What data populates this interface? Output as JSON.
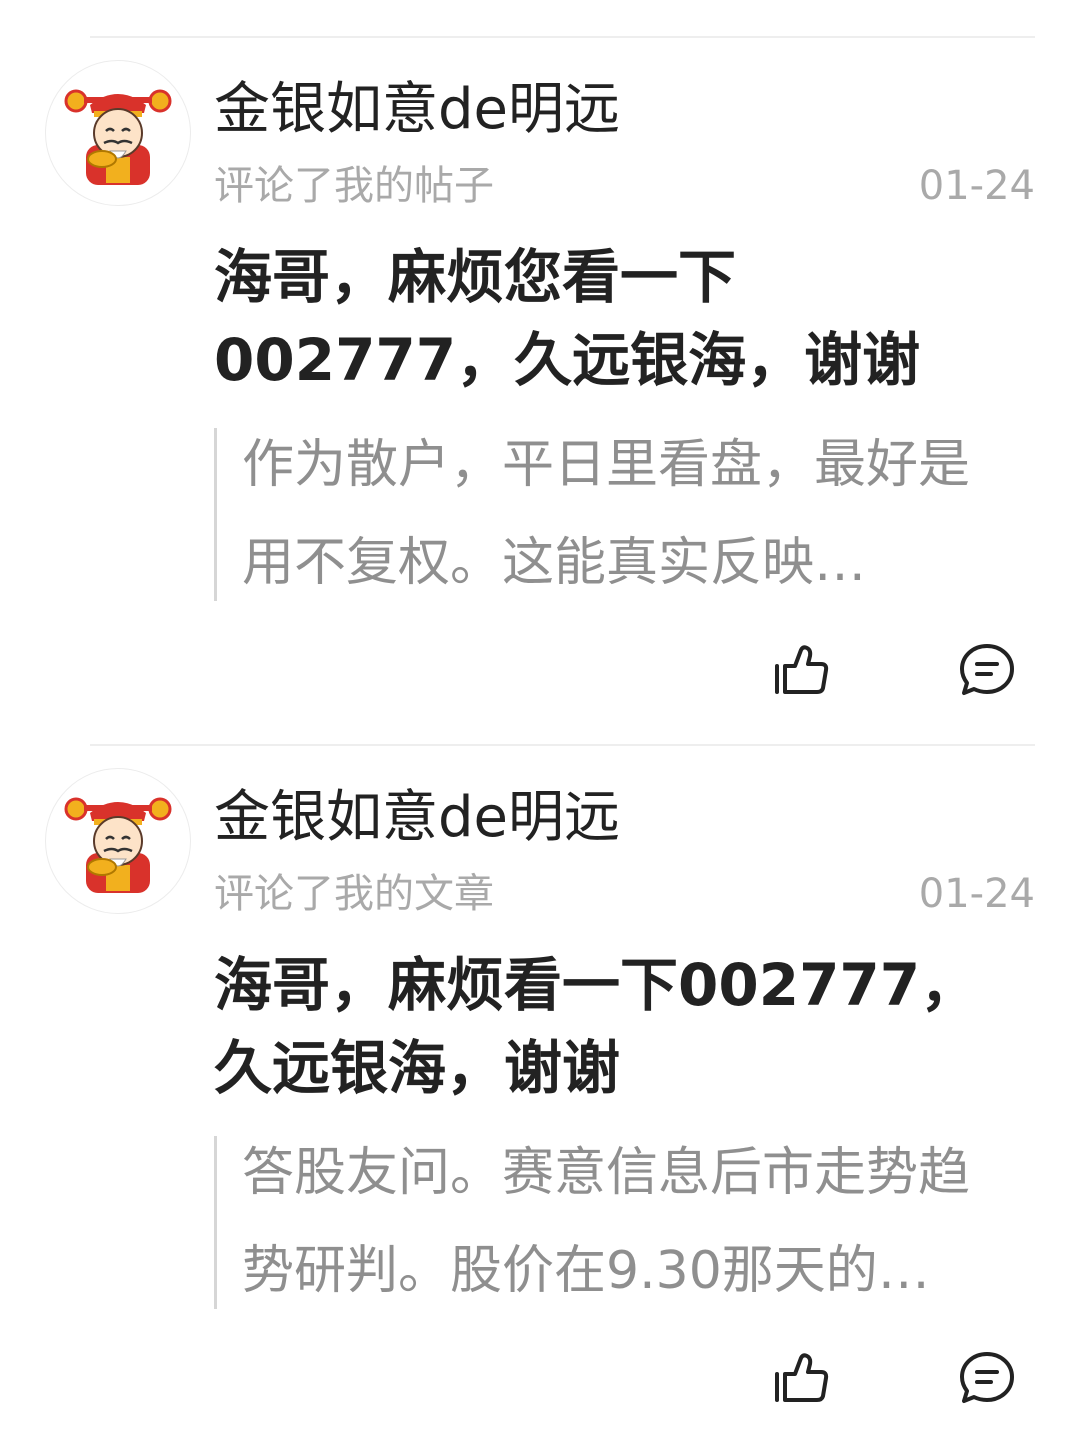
{
  "notifications": [
    {
      "author": "金银如意de明远",
      "action": "评论了我的帖子",
      "date": "01-24",
      "comment": "海哥，麻烦您看一下002777，久远银海，谢谢",
      "quote": "作为散户，平日里看盘，最好是用不复权。这能真实反映…",
      "avatar_icon": "god-of-wealth-avatar",
      "like_icon": "thumbs-up-icon",
      "reply_icon": "comment-bubble-icon"
    },
    {
      "author": "金银如意de明远",
      "action": "评论了我的文章",
      "date": "01-24",
      "comment": "海哥，麻烦看一下002777，久远银海，谢谢",
      "quote": "答股友问。赛意信息后市走势趋势研判。股价在9.30那天的…",
      "avatar_icon": "god-of-wealth-avatar",
      "like_icon": "thumbs-up-icon",
      "reply_icon": "comment-bubble-icon"
    }
  ],
  "colors": {
    "text_primary": "#222222",
    "text_secondary": "#a9a9a9",
    "quote_text": "#8f8f8f",
    "divider": "#eeeeee",
    "avatar_red": "#d9322b",
    "avatar_gold": "#f2b01e"
  }
}
